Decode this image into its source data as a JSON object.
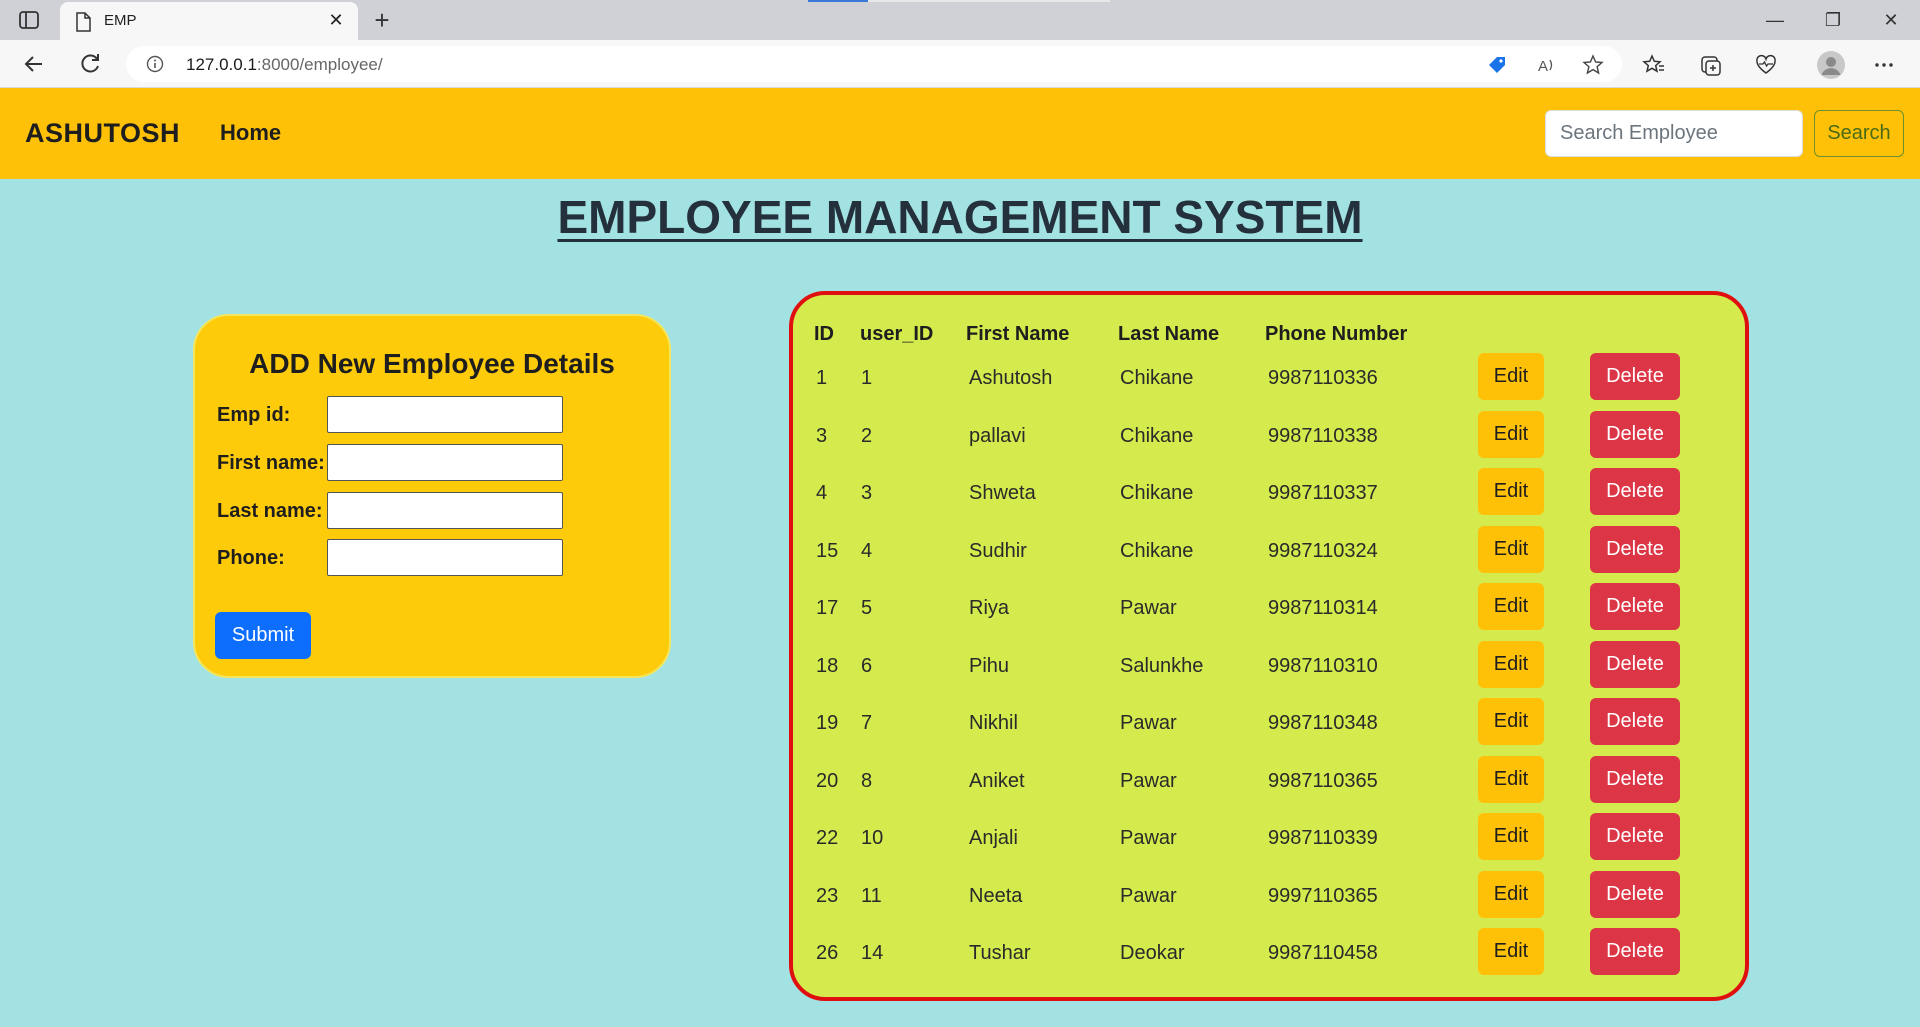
{
  "browser": {
    "tab_title": "EMP",
    "url_host": "127.0.0.1",
    "url_path": ":8000/employee/"
  },
  "navbar": {
    "brand": "ASHUTOSH",
    "home_link": "Home",
    "search_placeholder": "Search Employee",
    "search_button": "Search"
  },
  "page_title": "EMPLOYEE MANAGEMENT SYSTEM",
  "form": {
    "title": "ADD New Employee Details",
    "fields": [
      {
        "label": "Emp id:",
        "value": ""
      },
      {
        "label": "First name:",
        "value": ""
      },
      {
        "label": "Last name:",
        "value": ""
      },
      {
        "label": "Phone:",
        "value": ""
      }
    ],
    "submit_label": "Submit"
  },
  "table": {
    "headers": [
      "ID",
      "user_ID",
      "First Name",
      "Last Name",
      "Phone Number"
    ],
    "edit_label": "Edit",
    "delete_label": "Delete",
    "rows": [
      {
        "id": "1",
        "user_id": "1",
        "first": "Ashutosh",
        "last": "Chikane",
        "phone": "9987110336"
      },
      {
        "id": "3",
        "user_id": "2",
        "first": "pallavi",
        "last": "Chikane",
        "phone": "9987110338"
      },
      {
        "id": "4",
        "user_id": "3",
        "first": "Shweta",
        "last": "Chikane",
        "phone": "9987110337"
      },
      {
        "id": "15",
        "user_id": "4",
        "first": "Sudhir",
        "last": "Chikane",
        "phone": "9987110324"
      },
      {
        "id": "17",
        "user_id": "5",
        "first": "Riya",
        "last": "Pawar",
        "phone": "9987110314"
      },
      {
        "id": "18",
        "user_id": "6",
        "first": "Pihu",
        "last": "Salunkhe",
        "phone": "9987110310"
      },
      {
        "id": "19",
        "user_id": "7",
        "first": "Nikhil",
        "last": "Pawar",
        "phone": "9987110348"
      },
      {
        "id": "20",
        "user_id": "8",
        "first": "Aniket",
        "last": "Pawar",
        "phone": "9987110365"
      },
      {
        "id": "22",
        "user_id": "10",
        "first": "Anjali",
        "last": "Pawar",
        "phone": "9987110339"
      },
      {
        "id": "23",
        "user_id": "11",
        "first": "Neeta",
        "last": "Pawar",
        "phone": "9997110365"
      },
      {
        "id": "26",
        "user_id": "14",
        "first": "Tushar",
        "last": "Deokar",
        "phone": "9987110458"
      }
    ]
  }
}
